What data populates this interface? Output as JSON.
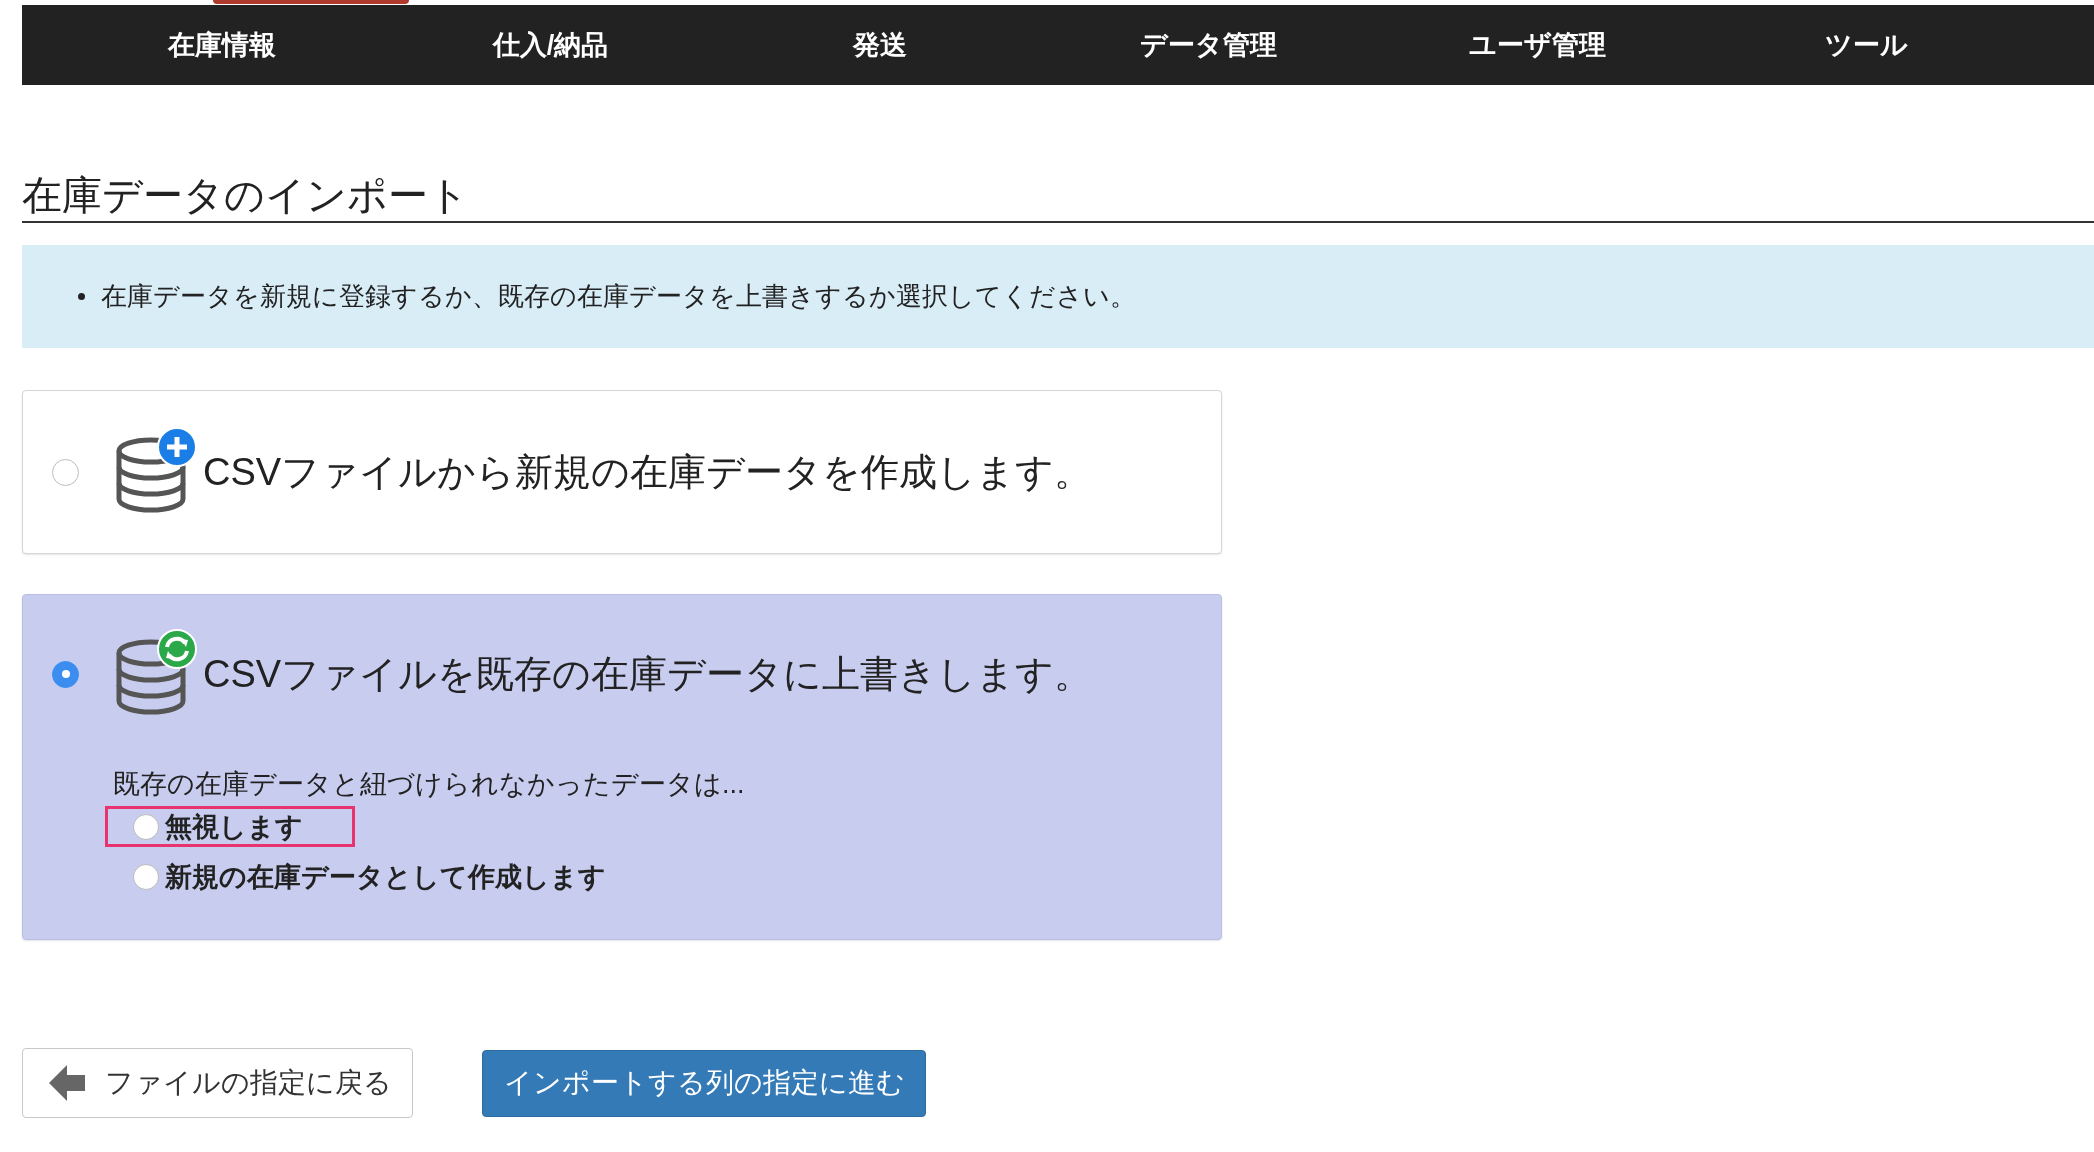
{
  "nav": {
    "items": [
      {
        "label": "在庫情報"
      },
      {
        "label": "仕入/納品"
      },
      {
        "label": "発送"
      },
      {
        "label": "データ管理"
      },
      {
        "label": "ユーザ管理"
      },
      {
        "label": "ツール"
      }
    ]
  },
  "title": "在庫データのインポート",
  "notice": {
    "items": [
      "在庫データを新規に登録するか、既存の在庫データを上書きするか選択してください。"
    ]
  },
  "options": [
    {
      "kind": "create",
      "label": "CSVファイルから新規の在庫データを作成します。",
      "selected": false
    },
    {
      "kind": "overwrite",
      "label": "CSVファイルを既存の在庫データに上書きします。",
      "selected": true,
      "sub_label": "既存の在庫データと紐づけられなかったデータは...",
      "sub_options": [
        {
          "label": "無視します",
          "selected": false,
          "highlighted": true
        },
        {
          "label": "新規の在庫データとして作成します",
          "selected": false,
          "highlighted": false
        }
      ]
    }
  ],
  "buttons": {
    "back": "ファイルの指定に戻る",
    "next": "インポートする列の指定に進む"
  }
}
